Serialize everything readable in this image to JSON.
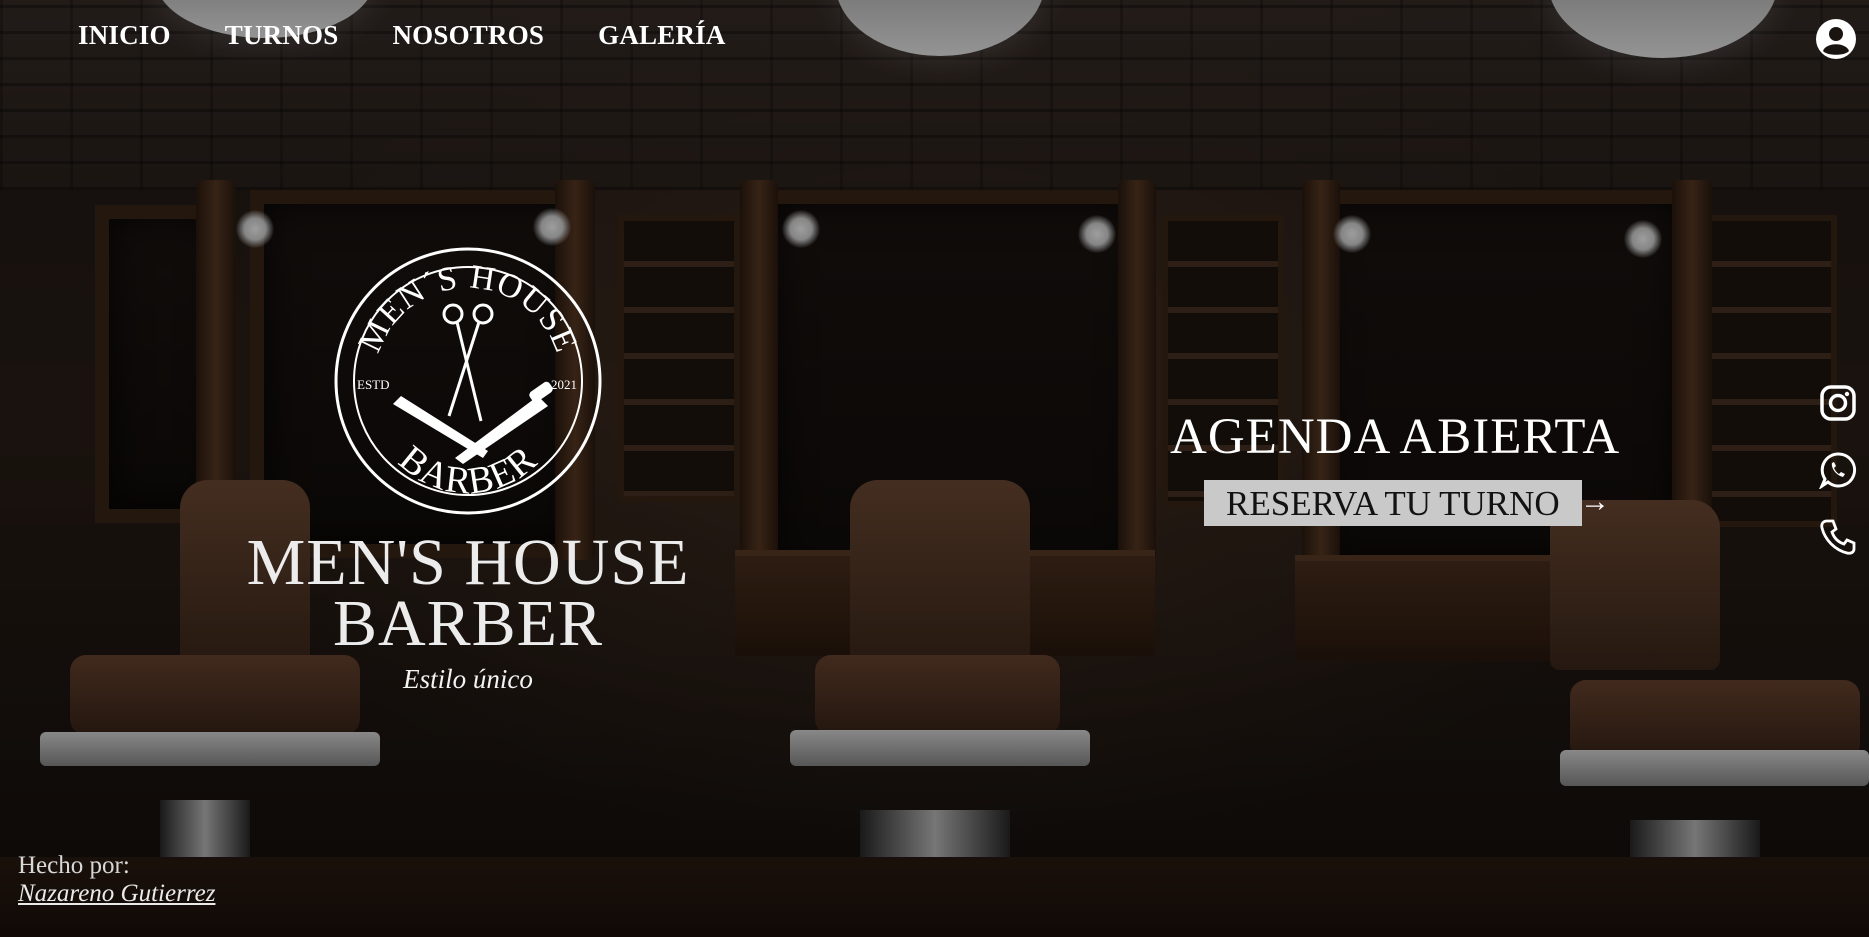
{
  "nav": {
    "items": [
      {
        "label": "INICIO"
      },
      {
        "label": "TURNOS"
      },
      {
        "label": "NOSOTROS"
      },
      {
        "label": "GALERÍA"
      }
    ],
    "account_icon": "user-circle-icon"
  },
  "logo": {
    "top_text": "MEN´S HOUSE",
    "bottom_text": "BARBER",
    "left_text": "ESTD",
    "right_text": "2021",
    "icons": [
      "scissors-icon",
      "razor-icon"
    ]
  },
  "hero": {
    "title_line1": "MEN'S HOUSE",
    "title_line2": "BARBER",
    "tagline": "Estilo único"
  },
  "booking": {
    "heading": "AGENDA ABIERTA",
    "button_label": "RESERVA TU TURNO",
    "arrow": "→"
  },
  "social": [
    {
      "icon": "instagram-icon"
    },
    {
      "icon": "whatsapp-icon"
    },
    {
      "icon": "phone-icon"
    }
  ],
  "footer": {
    "made_by": "Hecho por:",
    "author": "Nazareno Gutierrez"
  }
}
